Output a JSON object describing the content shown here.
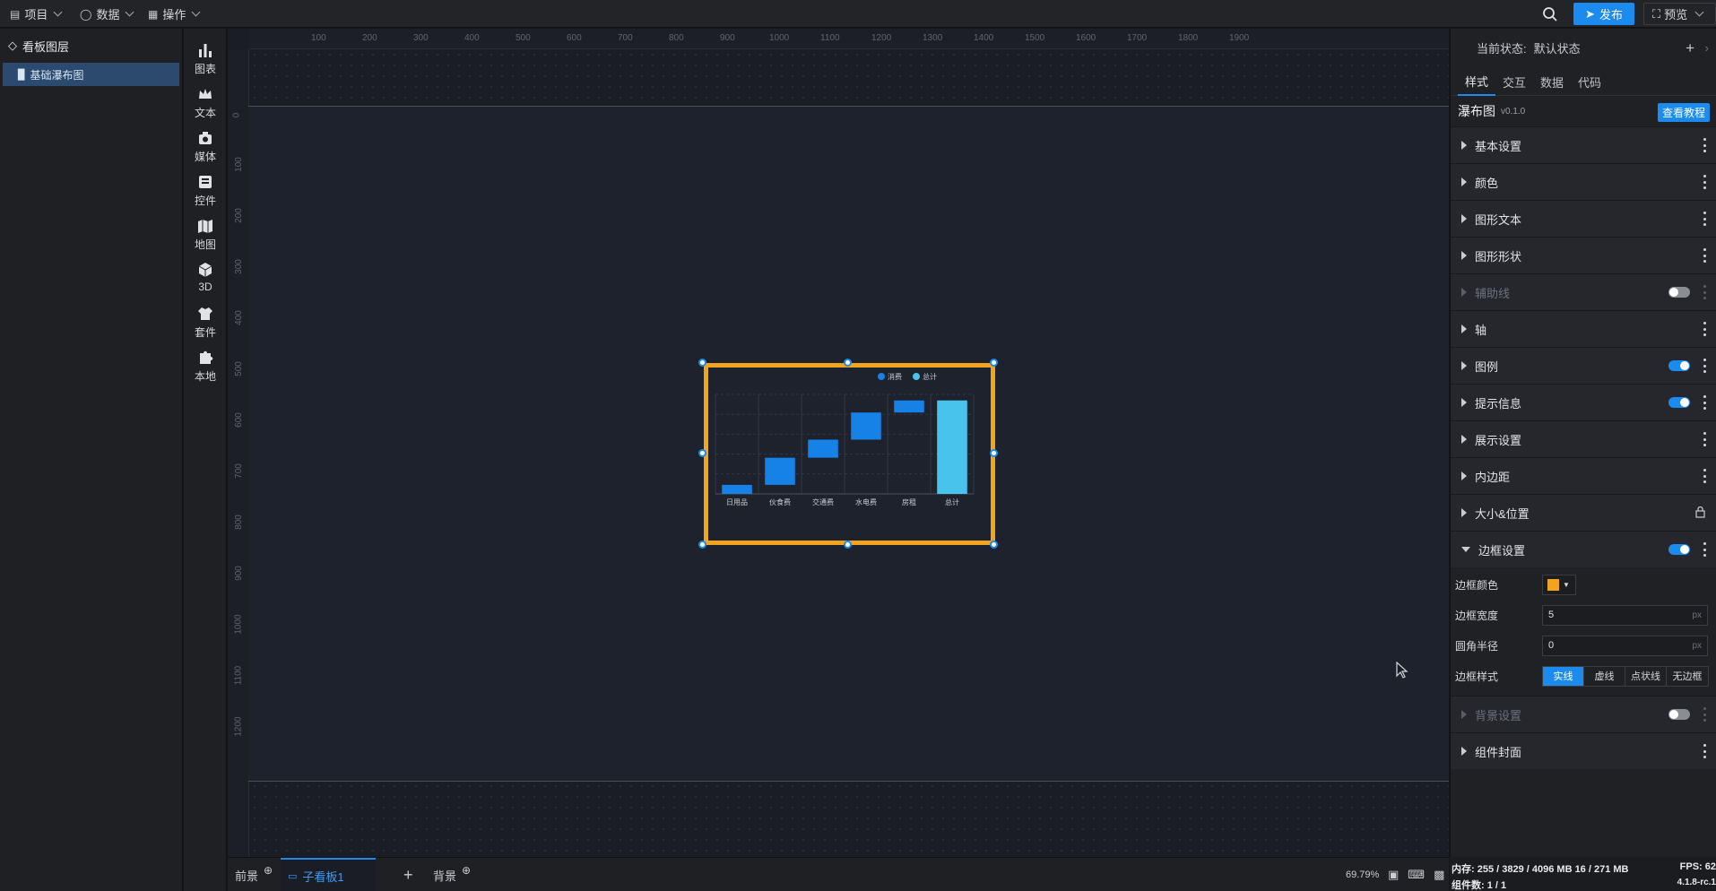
{
  "menu": {
    "project": "项目",
    "data": "数据",
    "operate": "操作"
  },
  "header": {
    "publish": "发布",
    "preview": "预览"
  },
  "layers": {
    "title": "看板图层",
    "items": [
      "基础瀑布图"
    ]
  },
  "components": [
    "图表",
    "文本",
    "媒体",
    "控件",
    "地图",
    "3D",
    "套件",
    "本地"
  ],
  "ruler": {
    "top": [
      "100",
      "200",
      "300",
      "400",
      "500",
      "600",
      "700",
      "800",
      "900",
      "1000",
      "1100",
      "1200",
      "1300",
      "1400",
      "1500",
      "1600",
      "1700",
      "1800",
      "1900"
    ],
    "left": [
      "0",
      "100",
      "200",
      "300",
      "400",
      "500",
      "600",
      "700",
      "800",
      "900",
      "1000",
      "1100",
      "1200"
    ]
  },
  "chart_data": {
    "type": "bar",
    "subtype": "waterfall",
    "categories": [
      "日用品",
      "伙食费",
      "交通费",
      "水电费",
      "房租",
      "总计"
    ],
    "series": [
      {
        "name": "消费",
        "color": "#1681e6"
      },
      {
        "name": "总计",
        "color": "#48c4ec"
      }
    ],
    "legend": [
      "消费",
      "总计"
    ],
    "increments": [
      300,
      900,
      600,
      900,
      400
    ],
    "base": [
      0,
      300,
      1200,
      1800,
      2700
    ],
    "total": 3100,
    "ylim": [
      0,
      3300
    ],
    "legend_position": "top-right",
    "grid": true
  },
  "bottom": {
    "tabs": [
      "前景",
      "子看板1",
      "背景"
    ],
    "zoom": "69.79%"
  },
  "panel": {
    "status_label": "当前状态:",
    "status_value": "默认状态",
    "tabs": [
      "样式",
      "交互",
      "数据",
      "代码"
    ],
    "component_name": "瀑布图",
    "version": "v0.1.0",
    "tutorial": "查看教程",
    "sections": [
      {
        "label": "基本设置",
        "toggle": null,
        "dim": false
      },
      {
        "label": "颜色",
        "toggle": null,
        "dim": false
      },
      {
        "label": "图形文本",
        "toggle": null,
        "dim": false
      },
      {
        "label": "图形形状",
        "toggle": null,
        "dim": false
      },
      {
        "label": "辅助线",
        "toggle": "off",
        "dim": true
      },
      {
        "label": "轴",
        "toggle": null,
        "dim": false
      },
      {
        "label": "图例",
        "toggle": "on",
        "dim": false
      },
      {
        "label": "提示信息",
        "toggle": "on",
        "dim": false
      },
      {
        "label": "展示设置",
        "toggle": null,
        "dim": false
      },
      {
        "label": "内边距",
        "toggle": null,
        "dim": false
      },
      {
        "label": "大小&位置",
        "toggle": "lock",
        "dim": false
      },
      {
        "label": "边框设置",
        "toggle": "on",
        "dim": false,
        "open": true
      }
    ],
    "border": {
      "color_label": "边框颜色",
      "color_value": "#f2a41f",
      "width_label": "边框宽度",
      "width_value": "5",
      "radius_label": "圆角半径",
      "radius_value": "0",
      "unit": "px",
      "style_label": "边框样式",
      "styles": [
        "实线",
        "虚线",
        "点状线",
        "无边框"
      ],
      "active_style": "实线"
    },
    "after_sections": [
      {
        "label": "背景设置",
        "toggle": "off",
        "dim": true
      },
      {
        "label": "组件封面",
        "toggle": null,
        "dim": false
      }
    ]
  },
  "footer": {
    "memory": "内存: 255 / 3829 / 4096 MB  16 / 271 MB",
    "count": "组件数: 1 / 1",
    "fps": "FPS: 62",
    "version": "4.1.8-rc.1"
  },
  "colors": {
    "accent": "#1b8bf0",
    "border_orange": "#f2a41f"
  }
}
